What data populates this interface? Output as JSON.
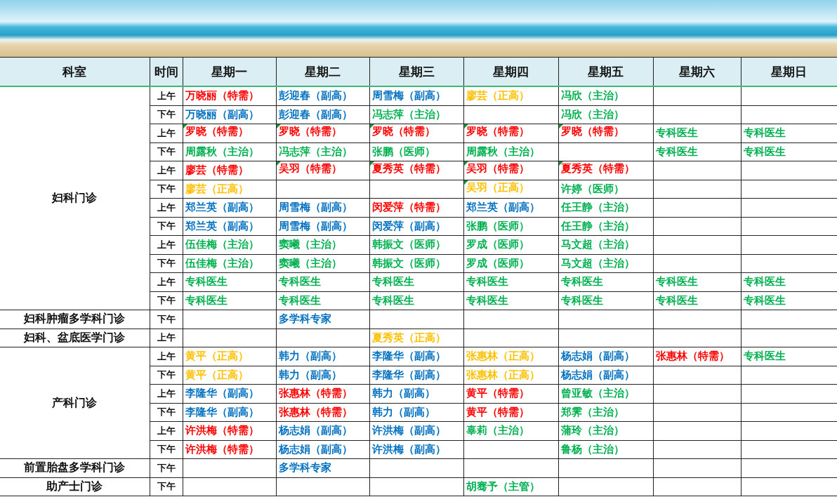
{
  "header": {
    "department": "科室",
    "time": "时间",
    "days": [
      "星期一",
      "星期二",
      "星期三",
      "星期四",
      "星期五",
      "星期六",
      "星期日"
    ]
  },
  "sections": [
    {
      "department": "妇科门诊",
      "slots": [
        {
          "time": "上午",
          "cells": [
            {
              "text": "万晓丽（特需）",
              "color": "#ff0000",
              "flagged": false
            },
            {
              "text": "彭迎春（副高）",
              "color": "#0070c0",
              "flagged": false
            },
            {
              "text": "周雪梅（副高）",
              "color": "#0070c0",
              "flagged": false
            },
            {
              "text": "廖芸（正高）",
              "color": "#ffc000",
              "flagged": false
            },
            {
              "text": "冯欣（主治）",
              "color": "#00b050",
              "flagged": false
            },
            null,
            null
          ]
        },
        {
          "time": "下午",
          "cells": [
            {
              "text": "万晓丽（副高）",
              "color": "#0070c0",
              "flagged": false
            },
            {
              "text": "彭迎春（副高）",
              "color": "#0070c0",
              "flagged": false
            },
            {
              "text": "冯志萍（主治）",
              "color": "#00b050",
              "flagged": false
            },
            null,
            {
              "text": "冯欣（主治）",
              "color": "#00b050",
              "flagged": false
            },
            null,
            null
          ]
        },
        {
          "time": "上午",
          "cells": [
            {
              "text": "罗晓（特需）",
              "color": "#ff0000",
              "flagged": true
            },
            {
              "text": "罗晓（特需）",
              "color": "#ff0000",
              "flagged": true
            },
            {
              "text": "罗晓（特需）",
              "color": "#ff0000",
              "flagged": true
            },
            {
              "text": "罗晓（特需）",
              "color": "#ff0000",
              "flagged": true
            },
            {
              "text": "罗晓（特需）",
              "color": "#ff0000",
              "flagged": true
            },
            {
              "text": "专科医生",
              "color": "#00b050",
              "flagged": false
            },
            {
              "text": "专科医生",
              "color": "#00b050",
              "flagged": false
            }
          ]
        },
        {
          "time": "下午",
          "cells": [
            {
              "text": "周露秋（主治）",
              "color": "#00b050",
              "flagged": false
            },
            {
              "text": "冯志萍（主治）",
              "color": "#00b050",
              "flagged": false
            },
            {
              "text": "张鹏（医师）",
              "color": "#00b050",
              "flagged": false
            },
            {
              "text": "周露秋（主治）",
              "color": "#00b050",
              "flagged": false
            },
            null,
            {
              "text": "专科医生",
              "color": "#00b050",
              "flagged": false
            },
            {
              "text": "专科医生",
              "color": "#00b050",
              "flagged": false
            }
          ]
        },
        {
          "time": "上午",
          "cells": [
            {
              "text": "廖芸（特需）",
              "color": "#ff0000",
              "flagged": false
            },
            {
              "text": "吴羽（特需）",
              "color": "#ff0000",
              "flagged": true
            },
            {
              "text": "夏秀英（特需）",
              "color": "#ff0000",
              "flagged": true
            },
            {
              "text": "吴羽（特需）",
              "color": "#ff0000",
              "flagged": true
            },
            {
              "text": "夏秀英（特需）",
              "color": "#ff0000",
              "flagged": true
            },
            null,
            null
          ]
        },
        {
          "time": "下午",
          "cells": [
            {
              "text": "廖芸（正高）",
              "color": "#ffc000",
              "flagged": false
            },
            null,
            null,
            {
              "text": "吴羽（正高）",
              "color": "#ffc000",
              "flagged": true
            },
            {
              "text": "许婷（医师）",
              "color": "#00b050",
              "flagged": false
            },
            null,
            null
          ]
        },
        {
          "time": "上午",
          "cells": [
            {
              "text": "郑兰英（副高）",
              "color": "#0070c0",
              "flagged": false
            },
            {
              "text": "周雪梅（副高）",
              "color": "#0070c0",
              "flagged": false
            },
            {
              "text": "闵爱萍（特需）",
              "color": "#ff0000",
              "flagged": false
            },
            {
              "text": "郑兰英（副高）",
              "color": "#0070c0",
              "flagged": false
            },
            {
              "text": "任王静（主治）",
              "color": "#00b050",
              "flagged": false
            },
            null,
            null
          ]
        },
        {
          "time": "下午",
          "cells": [
            {
              "text": "郑兰英（副高）",
              "color": "#0070c0",
              "flagged": false
            },
            {
              "text": "周雪梅（副高）",
              "color": "#0070c0",
              "flagged": false
            },
            {
              "text": "闵爱萍（副高）",
              "color": "#0070c0",
              "flagged": false
            },
            {
              "text": "张鹏（医师）",
              "color": "#00b050",
              "flagged": false
            },
            {
              "text": "任王静（主治）",
              "color": "#00b050",
              "flagged": false
            },
            null,
            null
          ]
        },
        {
          "time": "上午",
          "cells": [
            {
              "text": "伍佳梅（主治）",
              "color": "#00b050",
              "flagged": false
            },
            {
              "text": "窦曦（主治）",
              "color": "#00b050",
              "flagged": false
            },
            {
              "text": "韩振文（医师）",
              "color": "#00b050",
              "flagged": false
            },
            {
              "text": "罗成（医师）",
              "color": "#00b050",
              "flagged": false
            },
            {
              "text": "马文超（主治）",
              "color": "#00b050",
              "flagged": false
            },
            null,
            null
          ]
        },
        {
          "time": "下午",
          "cells": [
            {
              "text": "伍佳梅（主治）",
              "color": "#00b050",
              "flagged": false
            },
            {
              "text": "窦曦（主治）",
              "color": "#00b050",
              "flagged": false
            },
            {
              "text": "韩振文（医师）",
              "color": "#00b050",
              "flagged": false
            },
            {
              "text": "罗成（医师）",
              "color": "#00b050",
              "flagged": false
            },
            {
              "text": "马文超（主治）",
              "color": "#00b050",
              "flagged": false
            },
            null,
            null
          ]
        },
        {
          "time": "上午",
          "cells": [
            {
              "text": "专科医生",
              "color": "#00b050",
              "flagged": false
            },
            {
              "text": "专科医生",
              "color": "#00b050",
              "flagged": false
            },
            {
              "text": "专科医生",
              "color": "#00b050",
              "flagged": false
            },
            {
              "text": "专科医生",
              "color": "#00b050",
              "flagged": false
            },
            {
              "text": "专科医生",
              "color": "#00b050",
              "flagged": false
            },
            {
              "text": "专科医生",
              "color": "#00b050",
              "flagged": false
            },
            {
              "text": "专科医生",
              "color": "#00b050",
              "flagged": false
            }
          ]
        },
        {
          "time": "下午",
          "cells": [
            {
              "text": "专科医生",
              "color": "#00b050",
              "flagged": false
            },
            {
              "text": "专科医生",
              "color": "#00b050",
              "flagged": false
            },
            {
              "text": "专科医生",
              "color": "#00b050",
              "flagged": false
            },
            {
              "text": "专科医生",
              "color": "#00b050",
              "flagged": false
            },
            {
              "text": "专科医生",
              "color": "#00b050",
              "flagged": false
            },
            {
              "text": "专科医生",
              "color": "#00b050",
              "flagged": false
            },
            {
              "text": "专科医生",
              "color": "#00b050",
              "flagged": false
            }
          ]
        }
      ]
    },
    {
      "department": "妇科肿瘤多学科门诊",
      "slots": [
        {
          "time": "下午",
          "cells": [
            null,
            {
              "text": "多学科专家",
              "color": "#0070c0",
              "flagged": false
            },
            null,
            null,
            null,
            null,
            null
          ]
        }
      ]
    },
    {
      "department": "妇科、盆底医学门诊",
      "slots": [
        {
          "time": "上午",
          "cells": [
            null,
            null,
            {
              "text": "夏秀英（正高）",
              "color": "#ffc000",
              "flagged": false
            },
            null,
            null,
            null,
            null
          ]
        }
      ]
    },
    {
      "department": "产科门诊",
      "slots": [
        {
          "time": "上午",
          "cells": [
            {
              "text": "黄平（正高）",
              "color": "#ffc000",
              "flagged": false
            },
            {
              "text": "韩力（副高）",
              "color": "#0070c0",
              "flagged": false
            },
            {
              "text": "李隆华（副高）",
              "color": "#0070c0",
              "flagged": false
            },
            {
              "text": "张惠林（正高）",
              "color": "#ffc000",
              "flagged": false
            },
            {
              "text": "杨志娟（副高）",
              "color": "#0070c0",
              "flagged": false
            },
            {
              "text": "张惠林（特需）",
              "color": "#ff0000",
              "flagged": false
            },
            {
              "text": "专科医生",
              "color": "#00b050",
              "flagged": false
            }
          ]
        },
        {
          "time": "下午",
          "cells": [
            {
              "text": "黄平（正高）",
              "color": "#ffc000",
              "flagged": false
            },
            {
              "text": "韩力（副高）",
              "color": "#0070c0",
              "flagged": false
            },
            {
              "text": "李隆华（副高）",
              "color": "#0070c0",
              "flagged": false
            },
            {
              "text": "张惠林（正高）",
              "color": "#ffc000",
              "flagged": false
            },
            {
              "text": "杨志娟（副高）",
              "color": "#0070c0",
              "flagged": false
            },
            null,
            null
          ]
        },
        {
          "time": "上午",
          "cells": [
            {
              "text": "李隆华（副高）",
              "color": "#0070c0",
              "flagged": false
            },
            {
              "text": "张惠林（特需）",
              "color": "#ff0000",
              "flagged": false
            },
            {
              "text": "韩力（副高）",
              "color": "#0070c0",
              "flagged": false
            },
            {
              "text": "黄平（特需）",
              "color": "#ff0000",
              "flagged": false
            },
            {
              "text": "曾亚敏（主治）",
              "color": "#00b050",
              "flagged": false
            },
            null,
            null
          ]
        },
        {
          "time": "下午",
          "cells": [
            {
              "text": "李隆华（副高）",
              "color": "#0070c0",
              "flagged": false
            },
            {
              "text": "张惠林（特需）",
              "color": "#ff0000",
              "flagged": false
            },
            {
              "text": "韩力（副高）",
              "color": "#0070c0",
              "flagged": false
            },
            {
              "text": "黄平（特需）",
              "color": "#ff0000",
              "flagged": false
            },
            {
              "text": "郑霁（主治）",
              "color": "#00b050",
              "flagged": false
            },
            null,
            null
          ]
        },
        {
          "time": "上午",
          "cells": [
            {
              "text": "许洪梅（特需）",
              "color": "#ff0000",
              "flagged": false
            },
            {
              "text": "杨志娟（副高）",
              "color": "#0070c0",
              "flagged": false
            },
            {
              "text": "许洪梅（副高）",
              "color": "#0070c0",
              "flagged": false
            },
            {
              "text": "辜莉（主治）",
              "color": "#00b050",
              "flagged": false
            },
            {
              "text": "蒲玲（主治）",
              "color": "#00b050",
              "flagged": false
            },
            null,
            null
          ]
        },
        {
          "time": "下午",
          "cells": [
            {
              "text": "许洪梅（特需）",
              "color": "#ff0000",
              "flagged": false
            },
            {
              "text": "杨志娟（副高）",
              "color": "#0070c0",
              "flagged": false
            },
            {
              "text": "许洪梅（副高）",
              "color": "#0070c0",
              "flagged": false
            },
            null,
            {
              "text": "鲁杨（主治）",
              "color": "#00b050",
              "flagged": false
            },
            null,
            null
          ]
        }
      ]
    },
    {
      "department": "前置胎盘多学科门诊",
      "slots": [
        {
          "time": "下午",
          "cells": [
            null,
            {
              "text": "多学科专家",
              "color": "#0070c0",
              "flagged": false
            },
            null,
            null,
            null,
            null,
            null
          ]
        }
      ]
    },
    {
      "department": "助产士门诊",
      "slots": [
        {
          "time": "下午",
          "cells": [
            null,
            null,
            null,
            {
              "text": "胡骞予（主管）",
              "color": "#00b050",
              "flagged": false
            },
            null,
            null,
            null
          ]
        }
      ]
    }
  ]
}
